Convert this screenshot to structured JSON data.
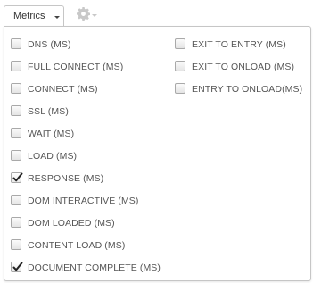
{
  "toolbar": {
    "metrics_label": "Metrics",
    "metrics_caret_icon": "caret-down-icon",
    "settings_icon": "gear-icon"
  },
  "metrics": {
    "left_column": [
      {
        "label": "DNS (MS)",
        "checked": false
      },
      {
        "label": "FULL CONNECT (MS)",
        "checked": false
      },
      {
        "label": "CONNECT (MS)",
        "checked": false
      },
      {
        "label": "SSL (MS)",
        "checked": false
      },
      {
        "label": "WAIT (MS)",
        "checked": false
      },
      {
        "label": "LOAD (MS)",
        "checked": false
      },
      {
        "label": "RESPONSE (MS)",
        "checked": true
      },
      {
        "label": "DOM INTERACTIVE (MS)",
        "checked": false
      },
      {
        "label": "DOM LOADED (MS)",
        "checked": false
      },
      {
        "label": "CONTENT LOAD (MS)",
        "checked": false
      },
      {
        "label": "DOCUMENT COMPLETE (MS)",
        "checked": true
      }
    ],
    "right_column": [
      {
        "label": "EXIT TO ENTRY (MS)",
        "checked": false
      },
      {
        "label": "EXIT TO ONLOAD (MS)",
        "checked": false
      },
      {
        "label": "ENTRY TO ONLOAD(MS)",
        "checked": false
      }
    ]
  },
  "colors": {
    "text": "#555555",
    "border": "#c6c6c6",
    "gear": "#c8c8c8"
  }
}
